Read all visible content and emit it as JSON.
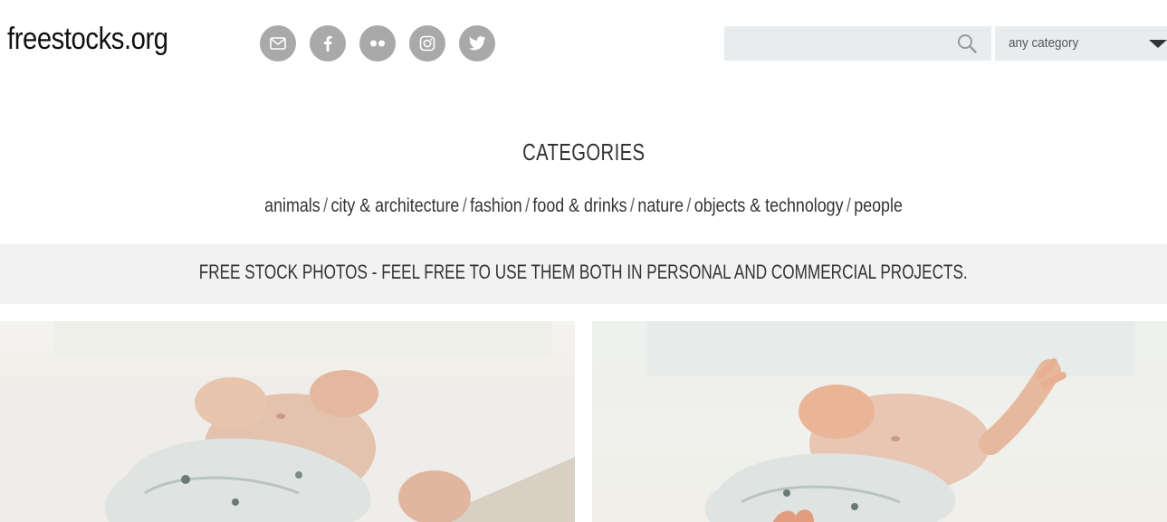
{
  "header": {
    "logo": "freestocks.org",
    "social": [
      "mail-icon",
      "facebook-icon",
      "flickr-icon",
      "instagram-icon",
      "twitter-icon"
    ],
    "search": {
      "placeholder": "",
      "value": ""
    },
    "category_select": {
      "selected": "any category"
    }
  },
  "categories": {
    "title": "CATEGORIES",
    "separator": "/",
    "links": [
      "animals",
      "city & architecture",
      "fashion",
      "food & drinks",
      "nature",
      "objects & technology",
      "people"
    ]
  },
  "banner": {
    "text": "FREE STOCK PHOTOS - FEEL FREE TO USE THEM BOTH IN PERSONAL AND COMMERCIAL PROJECTS."
  },
  "photos": [
    {
      "name": "baby-lying-blanket-photo"
    },
    {
      "name": "baby-reaching-photo"
    }
  ],
  "colors": {
    "social_bg": "#a9a9a9",
    "search_bg": "#e9ecef",
    "banner_bg": "#f2f2f2",
    "text": "#333333"
  }
}
